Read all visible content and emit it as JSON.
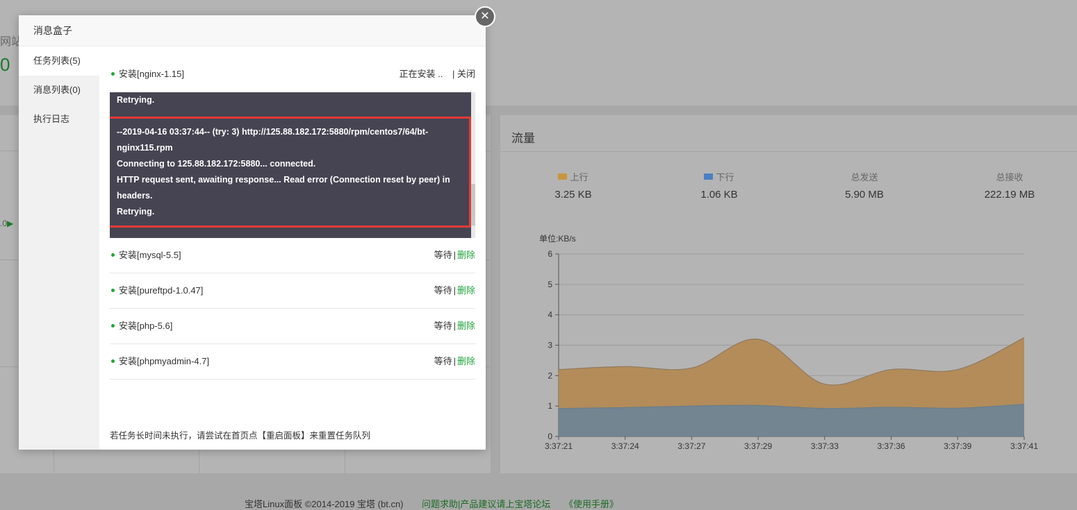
{
  "background": {
    "partial_site_label": "网站",
    "partial_site_count": "0",
    "partial_speed": ".0",
    "traffic": {
      "title": "流量",
      "stats": [
        {
          "label": "上行",
          "value": "3.25 KB",
          "color": "#c9963d"
        },
        {
          "label": "下行",
          "value": "1.06 KB",
          "color": "#4a7fc4"
        },
        {
          "label": "总发送",
          "value": "5.90 MB"
        },
        {
          "label": "总接收",
          "value": "222.19 MB"
        }
      ]
    },
    "footer": {
      "copyright": "宝塔Linux面板 ©2014-2019 宝塔 (bt.cn)",
      "forum_link": "问题求助|产品建议请上宝塔论坛",
      "manual_link": "《使用手册》"
    }
  },
  "chart_data": {
    "type": "area",
    "ylabel": "单位:KB/s",
    "ylim": [
      0,
      6
    ],
    "yticks": [
      "0",
      "1",
      "2",
      "3",
      "4",
      "5",
      "6"
    ],
    "x": [
      "3:37:21",
      "3:37:24",
      "3:37:27",
      "3:37:29",
      "3:37:33",
      "3:37:36",
      "3:37:39",
      "3:37:41"
    ],
    "series": [
      {
        "name": "上行",
        "values": [
          2.2,
          2.3,
          2.25,
          3.2,
          1.72,
          2.2,
          2.2,
          3.25
        ],
        "color": "#c9963d"
      },
      {
        "name": "下行",
        "values": [
          0.92,
          0.95,
          1.0,
          1.02,
          0.92,
          0.96,
          0.93,
          1.06
        ],
        "color": "#4a7fc4"
      }
    ]
  },
  "modal": {
    "title": "消息盒子",
    "close_icon": "close-icon",
    "sidebar": [
      {
        "label": "任务列表(5)"
      },
      {
        "label": "消息列表(0)"
      },
      {
        "label": "执行日志"
      }
    ],
    "current_task": {
      "name": "安装[nginx-1.15]",
      "status": "正在安装 ..",
      "close_label": "| 关闭",
      "log": [
        "Retrying.",
        "",
        "--2019-04-16 03:37:44-- (try: 3) http://125.88.182.172:5880/rpm/centos7/64/bt-nginx115.rpm",
        "Connecting to 125.88.182.172:5880... connected.",
        "HTTP request sent, awaiting response... Read error (Connection reset by peer) in headers.",
        "Retrying."
      ]
    },
    "tasks": [
      {
        "name": "安装[mysql-5.5]",
        "status": "等待",
        "action": "删除"
      },
      {
        "name": "安装[pureftpd-1.0.47]",
        "status": "等待",
        "action": "删除"
      },
      {
        "name": "安装[php-5.6]",
        "status": "等待",
        "action": "删除"
      },
      {
        "name": "安装[phpmyadmin-4.7]",
        "status": "等待",
        "action": "删除"
      }
    ],
    "hint": "若任务长时间未执行，请尝试在首页点【重启面板】来重置任务队列"
  }
}
